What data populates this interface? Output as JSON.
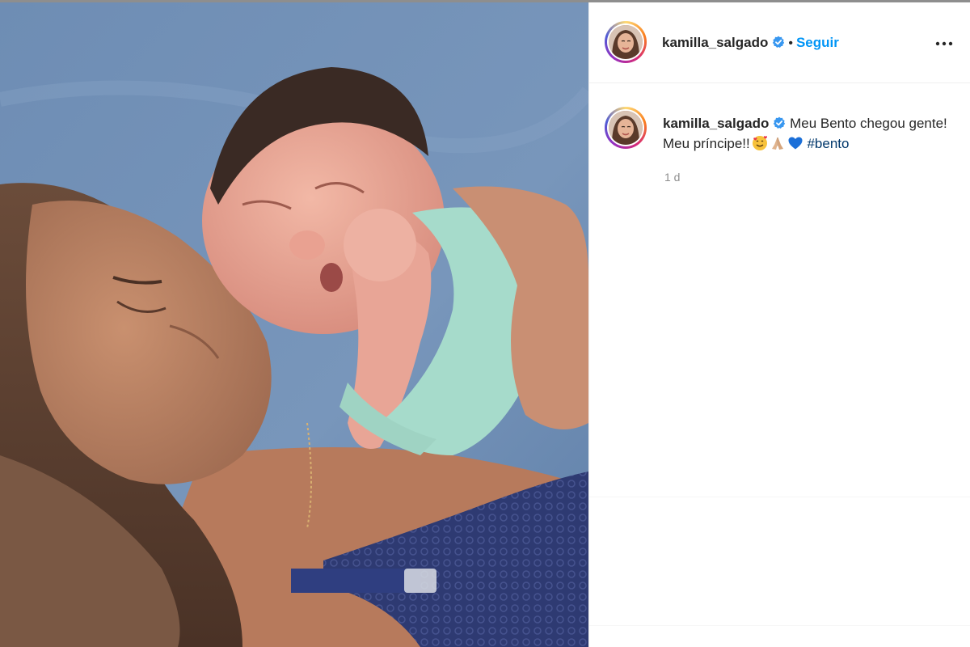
{
  "post": {
    "username": "kamilla_salgado",
    "follow_label": "Seguir",
    "separator": "•",
    "more_icon": "more-dots-icon",
    "verified_icon": "verified-badge-icon"
  },
  "caption": {
    "username": "kamilla_salgado",
    "text": "Meu Bento chegou gente! Meu príncipe!!",
    "emojis": [
      "smiling-face-with-hearts",
      "folded-hands",
      "blue-heart"
    ],
    "hashtag": "#bento",
    "timestamp": "1 d"
  },
  "colors": {
    "follow": "#0095f6",
    "hashtag": "#00376b",
    "verified": "#3897f0",
    "text": "#262626",
    "muted": "#8e8e8e"
  }
}
